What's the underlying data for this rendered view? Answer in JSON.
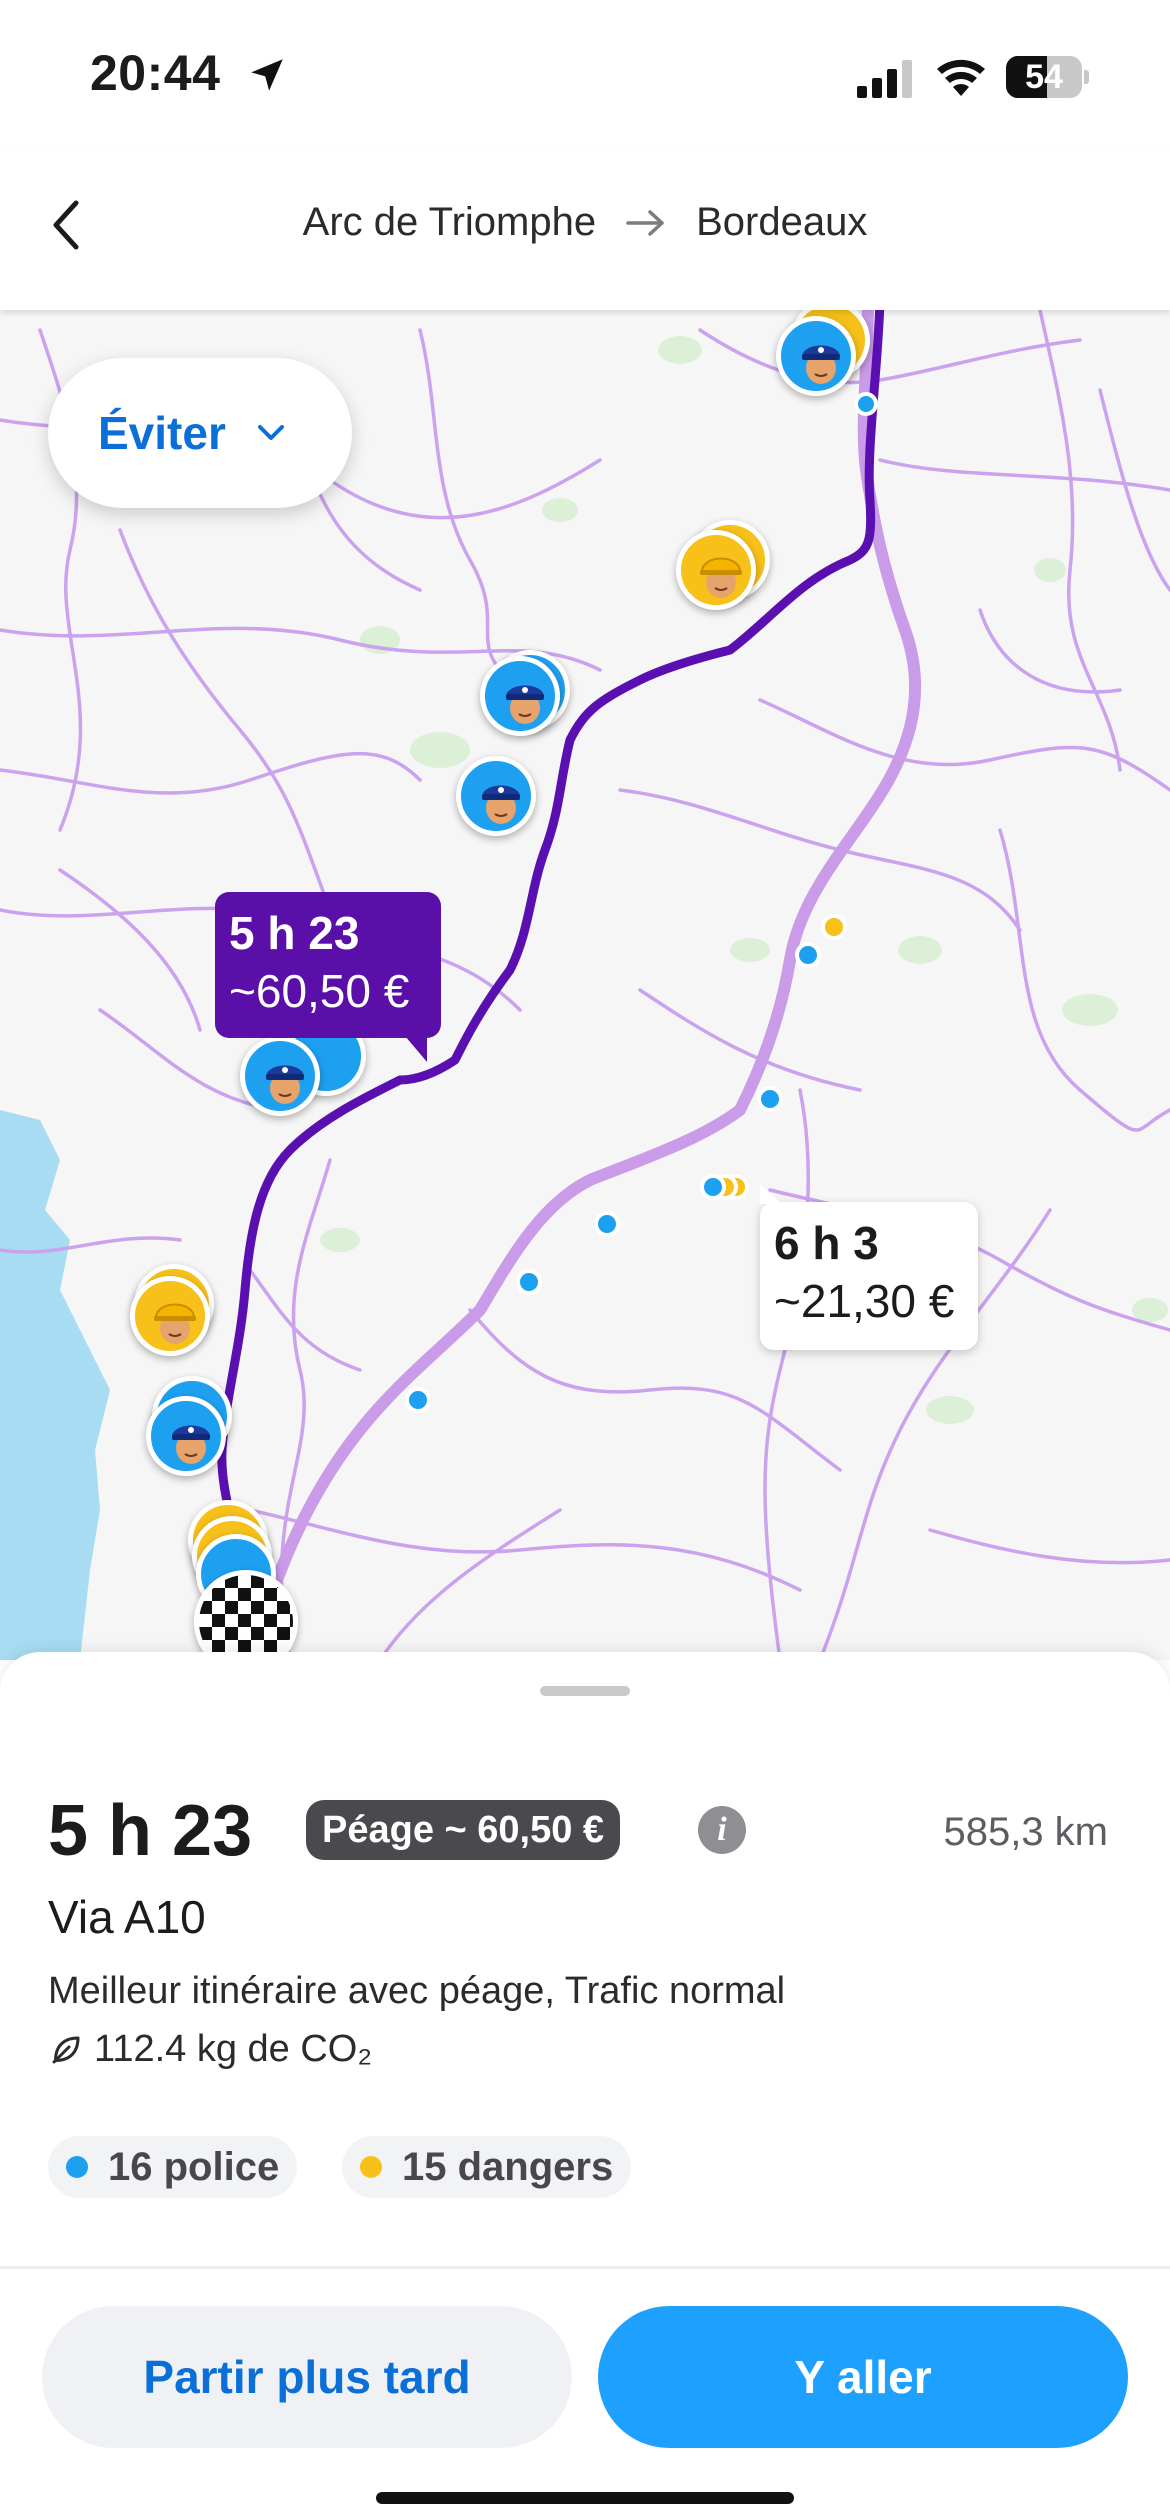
{
  "status_bar": {
    "time": "20:44",
    "battery": "54",
    "battery_level": 0.54,
    "icons": [
      "location-arrow-icon",
      "signal-icon",
      "wifi-icon",
      "battery-icon"
    ]
  },
  "header": {
    "origin": "Arc de Triomphe",
    "destination": "Bordeaux",
    "icons": [
      "back-chevron-icon",
      "route-arrow-icon"
    ]
  },
  "map": {
    "avoid_label": "Éviter",
    "main_route_bubble": {
      "time": "5 h 23",
      "price": "~60,50 €"
    },
    "alt_route_bubble": {
      "time": "6 h 3",
      "price": "~21,30 €"
    },
    "colors": {
      "main_route": "#5a10b0",
      "alt_route": "#c99be8",
      "police": "#1ea0f0",
      "hazard": "#f7c11a",
      "water": "#a8dcf2"
    },
    "markers": [
      "police-icon",
      "hazard-icon",
      "finish-flag-icon"
    ]
  },
  "sheet": {
    "duration": "5 h 23",
    "toll": "Péage ~ 60,50 €",
    "info_icon": "i",
    "distance": "585,3 km",
    "via": "Via A10",
    "description": "Meilleur itinéraire avec péage, Trafic normal",
    "co2": "112.4 kg de CO₂",
    "chips": [
      {
        "label": "16 police",
        "color": "#1ea0f0"
      },
      {
        "label": "15 dangers",
        "color": "#f7c11a"
      }
    ],
    "later_button": "Partir plus tard",
    "go_button": "Y aller"
  }
}
